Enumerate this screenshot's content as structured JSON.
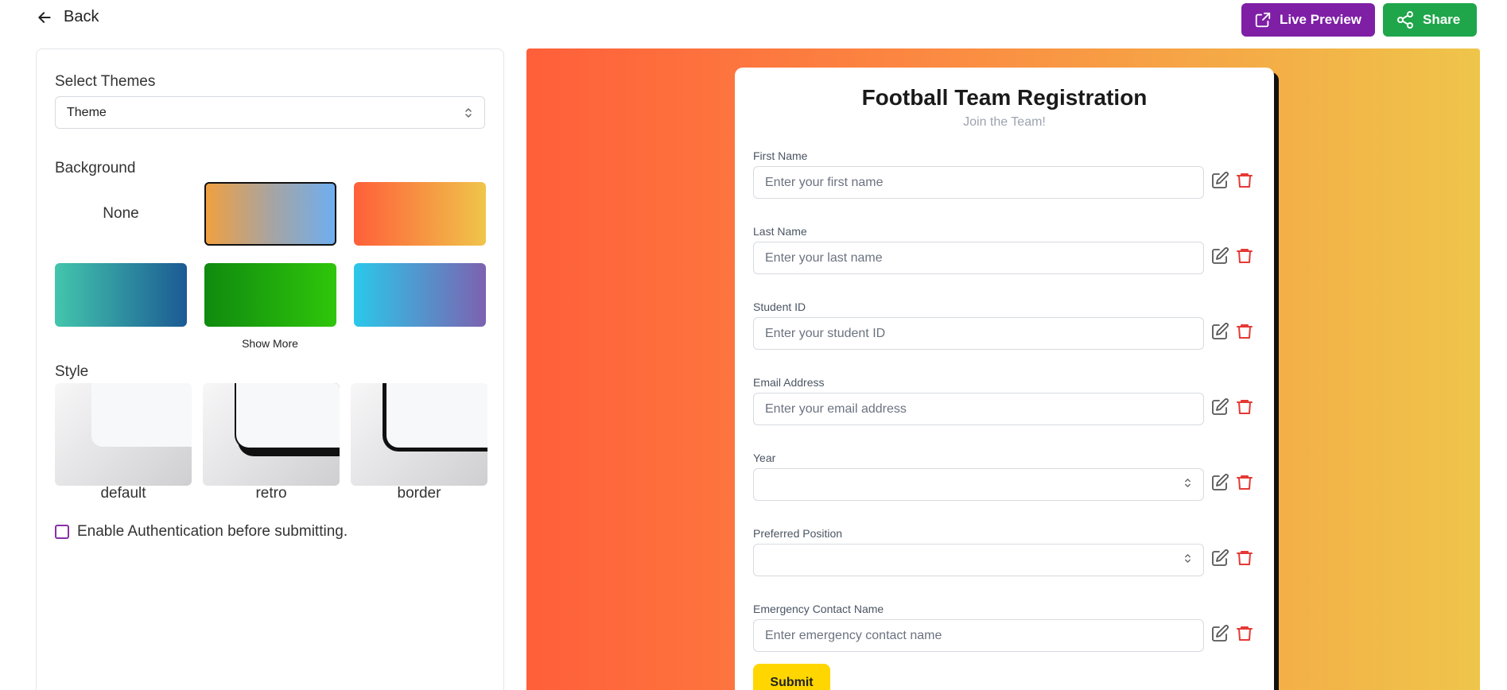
{
  "header": {
    "back_label": "Back",
    "live_preview_label": "Live Preview",
    "share_label": "Share",
    "live_preview_color": "#7e1fa6",
    "share_color": "#1fa64a"
  },
  "sidebar": {
    "themes_label": "Select Themes",
    "theme_select_value": "Theme",
    "background_label": "Background",
    "backgrounds": [
      {
        "label": "None"
      },
      {
        "gradient": [
          "#f0a040",
          "#6eaef0"
        ],
        "selected": true
      },
      {
        "gradient": [
          "#ff5f3a",
          "#efc54a"
        ]
      },
      {
        "gradient": [
          "#43c6ac",
          "#1b5a94"
        ]
      },
      {
        "gradient": [
          "#0f8a0f",
          "#2fc60a"
        ]
      },
      {
        "gradient": [
          "#2ac8ea",
          "#7c62b0"
        ]
      }
    ],
    "show_more_label": "Show More",
    "style_label": "Style",
    "styles": [
      {
        "label": "default"
      },
      {
        "label": "retro"
      },
      {
        "label": "border"
      }
    ],
    "auth_label": "Enable Authentication before submitting."
  },
  "form": {
    "title": "Football Team Registration",
    "subtitle": "Join the Team!",
    "fields": [
      {
        "label": "First Name",
        "placeholder": "Enter your first name",
        "type": "text"
      },
      {
        "label": "Last Name",
        "placeholder": "Enter your last name",
        "type": "text"
      },
      {
        "label": "Student ID",
        "placeholder": "Enter your student ID",
        "type": "text"
      },
      {
        "label": "Email Address",
        "placeholder": "Enter your email address",
        "type": "text"
      },
      {
        "label": "Year",
        "placeholder": "",
        "type": "select"
      },
      {
        "label": "Preferred Position",
        "placeholder": "",
        "type": "select"
      },
      {
        "label": "Emergency Contact Name",
        "placeholder": "Enter emergency contact name",
        "type": "text"
      }
    ],
    "submit_label": "Submit",
    "submit_color": "#ffd600",
    "delete_icon_color": "#e53935"
  }
}
